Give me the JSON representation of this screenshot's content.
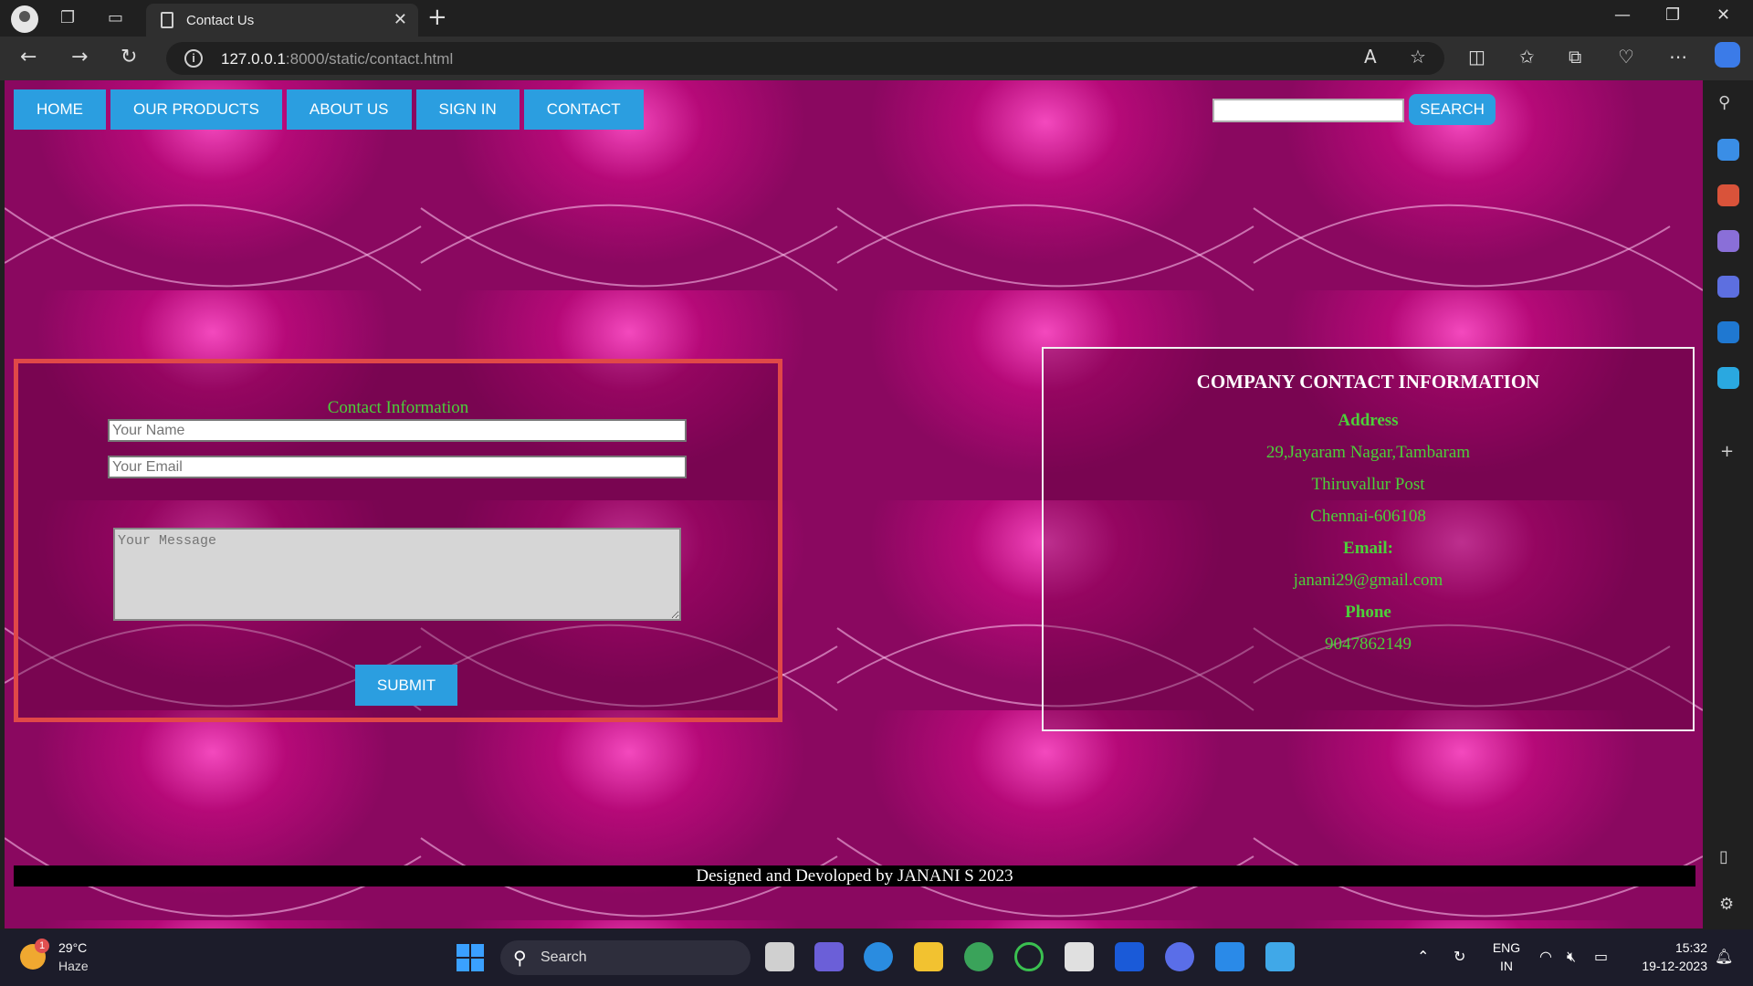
{
  "browser": {
    "tab_title": "Contact Us",
    "url_host": "127.0.0.1",
    "url_rest": ":8000/static/contact.html"
  },
  "nav": {
    "items": [
      {
        "label": "HOME"
      },
      {
        "label": "OUR PRODUCTS"
      },
      {
        "label": "ABOUT US"
      },
      {
        "label": "SIGN IN"
      },
      {
        "label": "CONTACT"
      }
    ],
    "search_button": "SEARCH",
    "search_value": ""
  },
  "contact_form": {
    "title": "Contact Information",
    "name_placeholder": "Your Name",
    "email_placeholder": "Your Email",
    "message_placeholder": "Your Message",
    "submit_label": "SUBMIT"
  },
  "company": {
    "title": "COMPANY CONTACT INFORMATION",
    "address_heading": "Address",
    "address_line1": "29,Jayaram Nagar,Tambaram",
    "address_line2": "Thiruvallur Post",
    "address_line3": "Chennai-606108",
    "email_heading": "Email:",
    "email": "janani29@gmail.com",
    "phone_heading": "Phone",
    "phone": "9047862149"
  },
  "footer": {
    "text": "Designed and Devoloped by JANANI S 2023"
  },
  "taskbar": {
    "weather_badge": "1",
    "temperature": "29°C",
    "condition": "Haze",
    "search_label": "Search",
    "lang_line1": "ENG",
    "lang_line2": "IN",
    "time": "15:32",
    "date": "19-12-2023"
  },
  "colors": {
    "accent_button": "#2b9ee0",
    "green_text": "#4ccf3a",
    "form_border": "#e04848",
    "page_magenta": "#8a0860"
  }
}
